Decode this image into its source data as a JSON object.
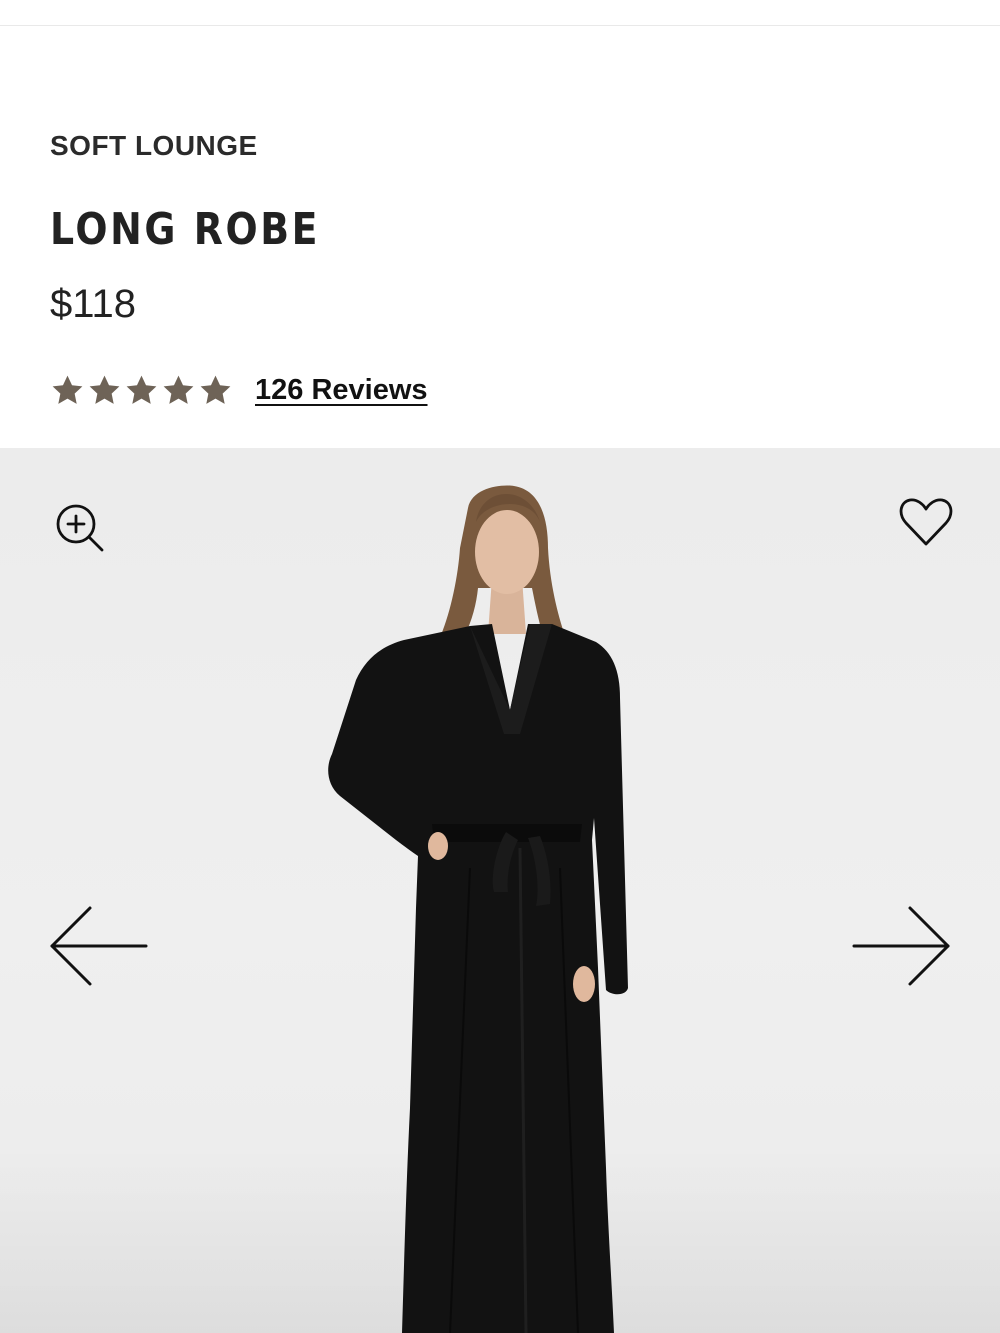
{
  "product": {
    "collection": "SOFT LOUNGE",
    "title": "LONG ROBE",
    "price": "$118",
    "rating": {
      "value": 5,
      "max": 5,
      "star_color": "#6e6357",
      "reviews_label": "126 Reviews"
    }
  },
  "gallery": {
    "background_color": "#ededed",
    "garment_color": "#121212",
    "icons": {
      "zoom": "zoom-in-icon",
      "wishlist": "heart-icon",
      "previous": "arrow-left-icon",
      "next": "arrow-right-icon"
    }
  }
}
